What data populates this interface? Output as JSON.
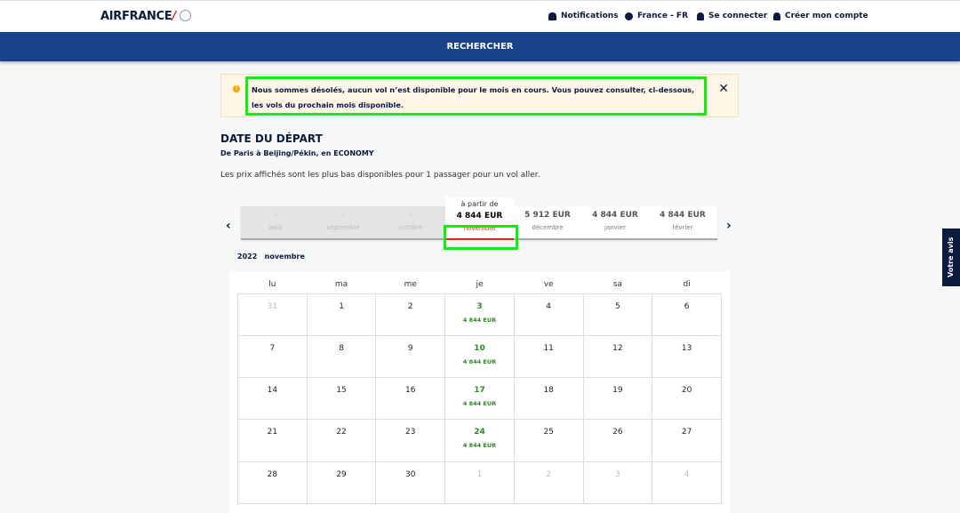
{
  "header": {
    "logo": "AIRFRANCE",
    "nav": [
      {
        "icon": "bell-icon",
        "label": "Notifications"
      },
      {
        "icon": "globe-icon",
        "label": "France - FR"
      },
      {
        "icon": "user-icon",
        "label": "Se connecter"
      },
      {
        "icon": "user-add-icon",
        "label": "Créer mon compte"
      }
    ]
  },
  "band": {
    "label": "RECHERCHER"
  },
  "alert": {
    "message": "Nous sommes désolés, aucun vol n’est disponible pour le mois en cours. Vous pouvez consulter, ci-dessous, les vols du prochain mois disponible.",
    "close": "✕"
  },
  "section": {
    "title": "DATE DU DÉPART",
    "route": "De Paris à Beijing/Pékin, en ECONOMY",
    "info": "Les prix affichés sont les plus bas disponibles pour 1 passager pour un vol aller."
  },
  "months": [
    {
      "price": "-",
      "name": "août"
    },
    {
      "price": "-",
      "name": "septembre"
    },
    {
      "price": "-",
      "name": "octobre"
    },
    {
      "price": "4 844 EUR",
      "name": "novembre",
      "prefix": "à partir de"
    },
    {
      "price": "5 912 EUR",
      "name": "décembre"
    },
    {
      "price": "4 844 EUR",
      "name": "janvier"
    },
    {
      "price": "4 844 EUR",
      "name": "février"
    }
  ],
  "calendar": {
    "year": "2022",
    "month": "novembre",
    "weekdays": [
      "lu",
      "ma",
      "me",
      "je",
      "ve",
      "sa",
      "di"
    ],
    "weeks": [
      [
        {
          "d": "31",
          "o": true
        },
        {
          "d": "1"
        },
        {
          "d": "2"
        },
        {
          "d": "3",
          "p": "4 844 EUR"
        },
        {
          "d": "4"
        },
        {
          "d": "5"
        },
        {
          "d": "6"
        }
      ],
      [
        {
          "d": "7"
        },
        {
          "d": "8"
        },
        {
          "d": "9"
        },
        {
          "d": "10",
          "p": "4 844 EUR"
        },
        {
          "d": "11"
        },
        {
          "d": "12"
        },
        {
          "d": "13"
        }
      ],
      [
        {
          "d": "14"
        },
        {
          "d": "15"
        },
        {
          "d": "16"
        },
        {
          "d": "17",
          "p": "4 844 EUR"
        },
        {
          "d": "18"
        },
        {
          "d": "19"
        },
        {
          "d": "20"
        }
      ],
      [
        {
          "d": "21"
        },
        {
          "d": "22"
        },
        {
          "d": "23"
        },
        {
          "d": "24",
          "p": "4 844 EUR"
        },
        {
          "d": "25"
        },
        {
          "d": "26"
        },
        {
          "d": "27"
        }
      ],
      [
        {
          "d": "28"
        },
        {
          "d": "29"
        },
        {
          "d": "30"
        },
        {
          "d": "1",
          "o": true
        },
        {
          "d": "2",
          "o": true
        },
        {
          "d": "3",
          "o": true
        },
        {
          "d": "4",
          "o": true
        }
      ]
    ]
  },
  "feedback": {
    "label": "Votre avis"
  },
  "colors": {
    "brand": "#16438a",
    "accent": "#e0231c",
    "available": "#2a8a22"
  }
}
